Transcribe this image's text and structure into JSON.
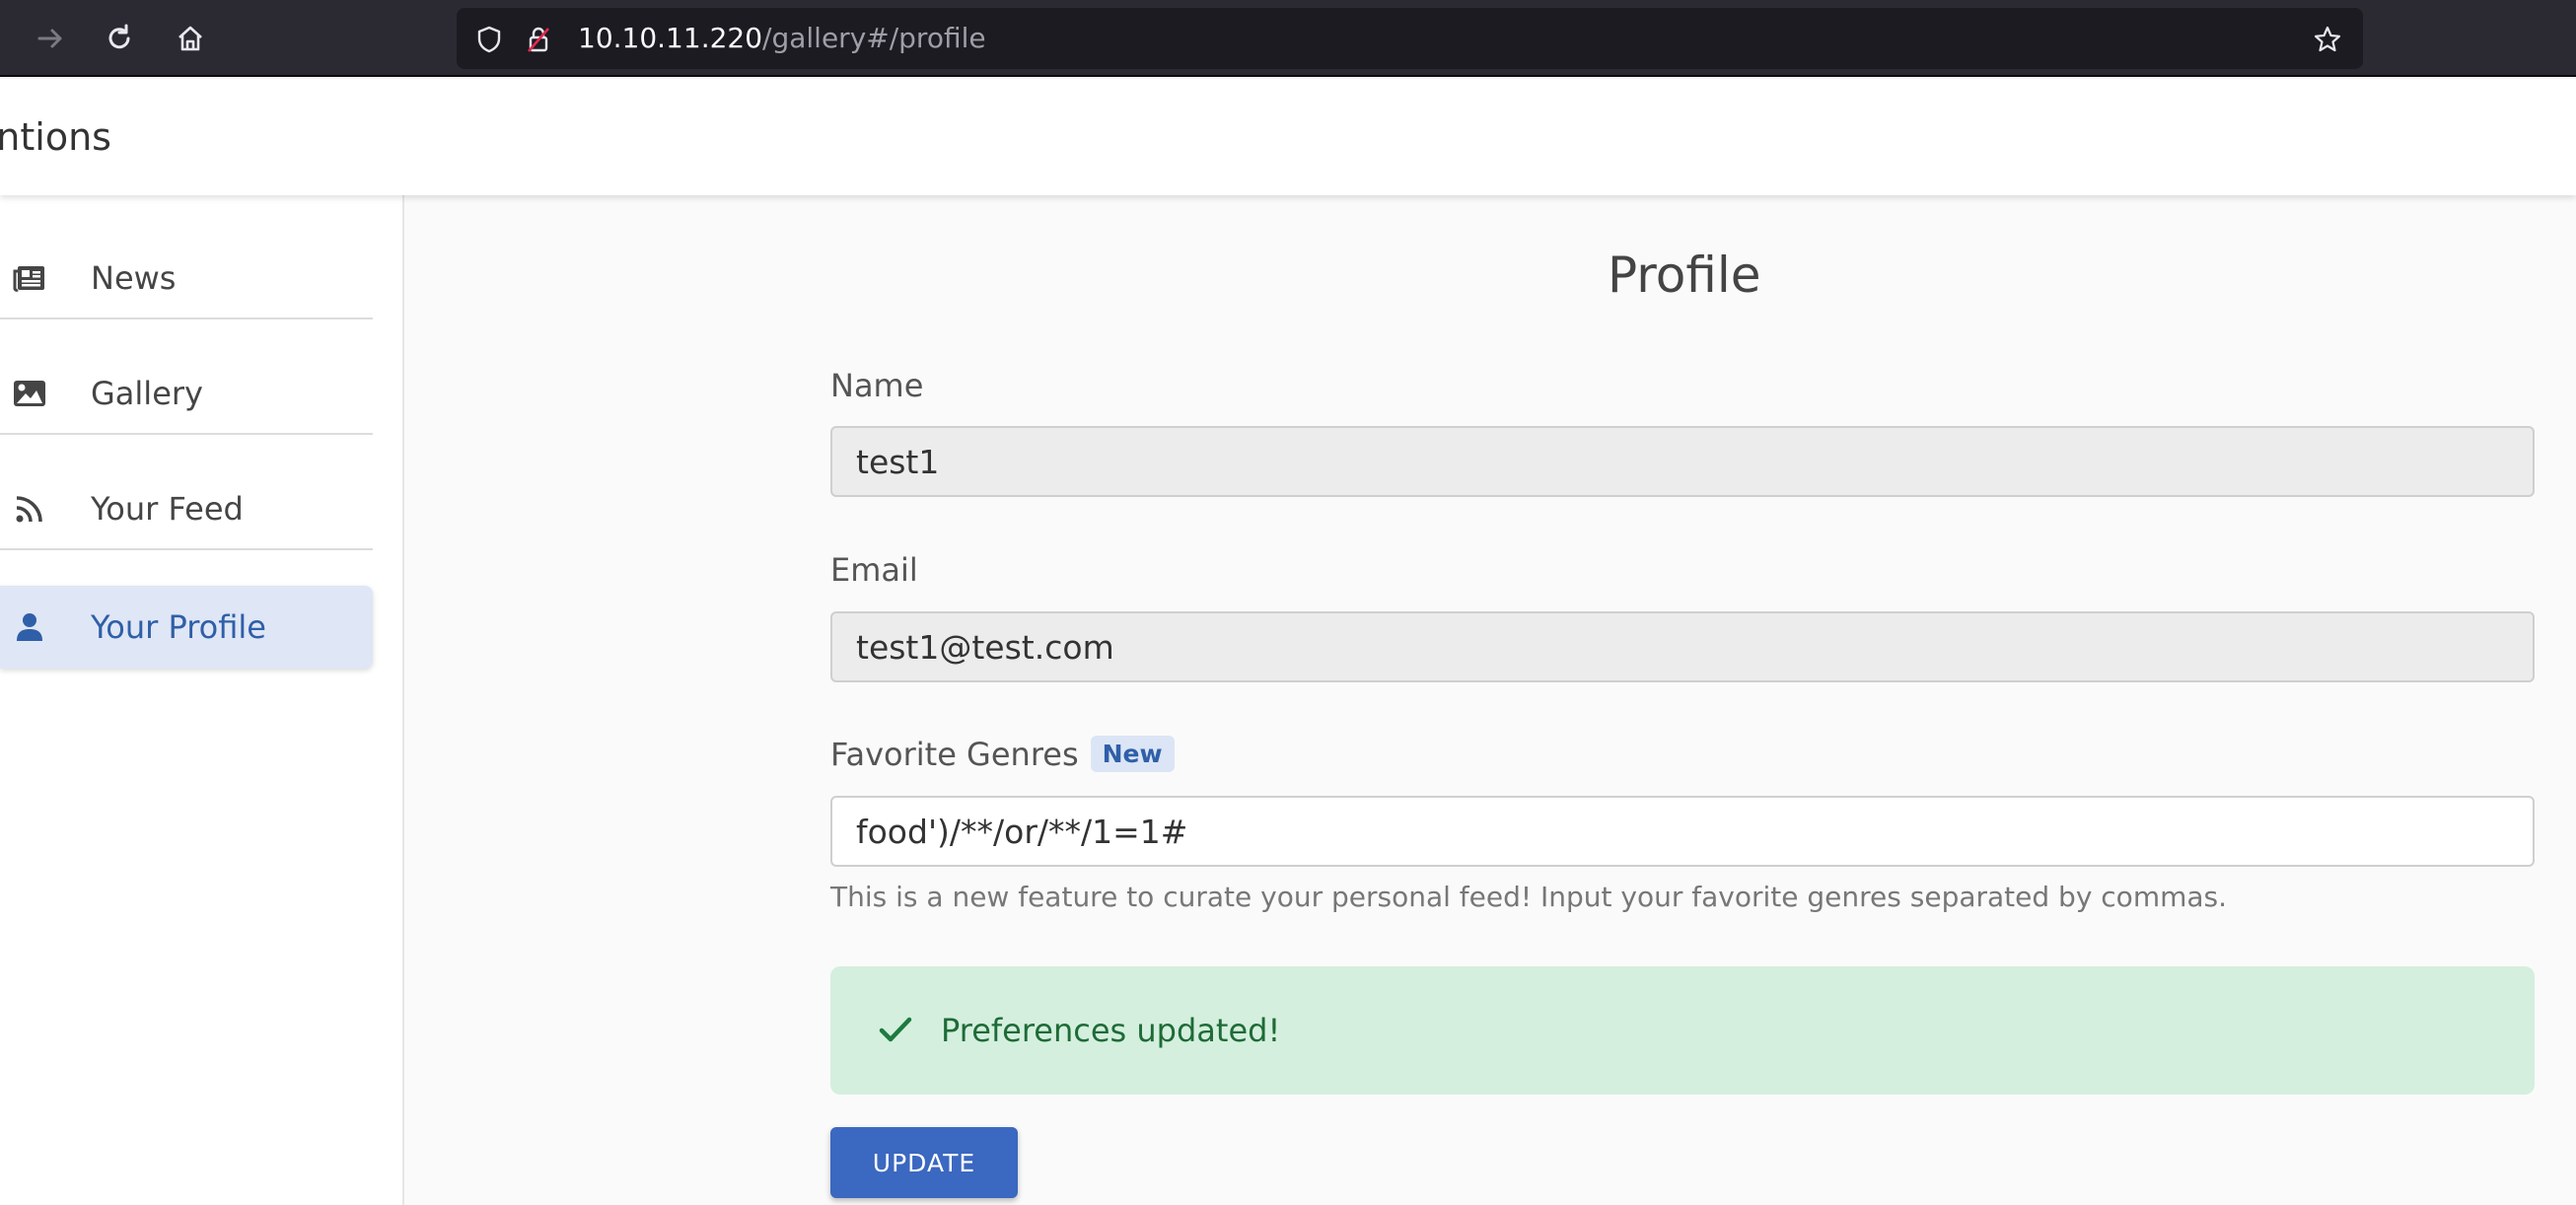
{
  "browser": {
    "url_host": "10.10.11.220",
    "url_path": "/gallery#/profile"
  },
  "header": {
    "title": "tentions"
  },
  "sidebar": {
    "items": [
      {
        "label": "News",
        "icon": "newspaper-icon"
      },
      {
        "label": "Gallery",
        "icon": "image-icon"
      },
      {
        "label": "Your Feed",
        "icon": "rss-icon"
      },
      {
        "label": "Your Profile",
        "icon": "user-icon",
        "active": true
      }
    ]
  },
  "profile": {
    "title": "Profile",
    "name_label": "Name",
    "name_value": "test1",
    "email_label": "Email",
    "email_value": "test1@test.com",
    "genres_label": "Favorite Genres",
    "genres_badge": "New",
    "genres_value": "food')/**/or/**/1=1#",
    "genres_help": "This is a new feature to curate your personal feed! Input your favorite genres separated by commas.",
    "alert_text": "Preferences updated!",
    "update_label": "UPDATE"
  },
  "colors": {
    "accent": "#3b68c0",
    "success_bg": "#d4efde",
    "success_text": "#1e6b37",
    "active_bg": "#dfe6f5"
  }
}
